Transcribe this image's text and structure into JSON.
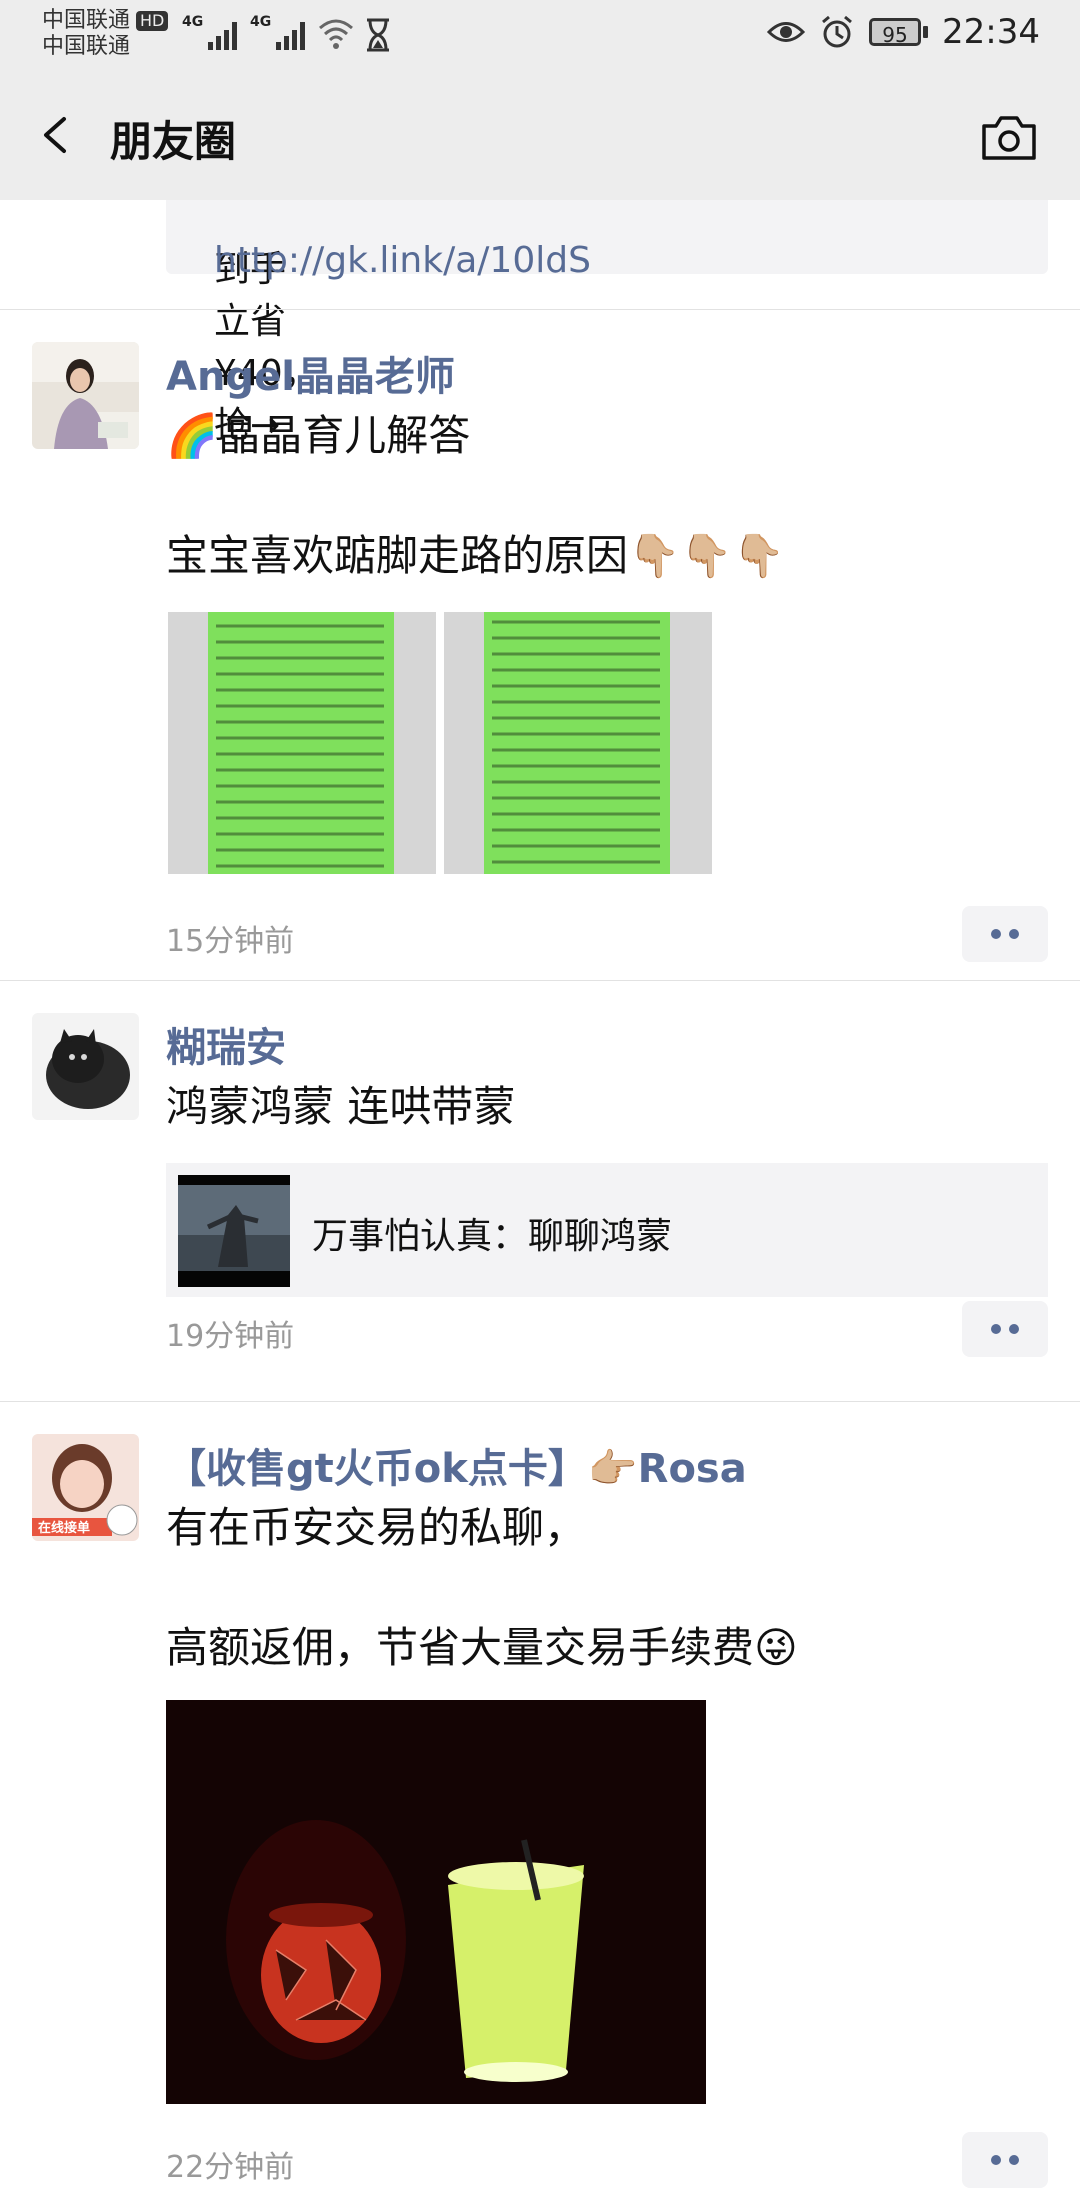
{
  "status_bar": {
    "carrier_1": "中国联通",
    "carrier_hd": "HD",
    "carrier_2": "中国联通",
    "net_1": "4G",
    "net_2": "4G",
    "battery": "95",
    "time": "22:34"
  },
  "nav": {
    "title": "朋友圈"
  },
  "top_snippet": {
    "text": "到手立省 ¥40，抢→",
    "link": "http://gk.link/a/10ldS"
  },
  "posts": [
    {
      "username": "Angel晶晶老师",
      "line_1": "🌈晶晶育儿解答",
      "line_2": "宝宝喜欢踮脚走路的原因👇🏼👇🏼👇🏼",
      "time": "15分钟前"
    },
    {
      "username": "糊瑞安",
      "line_1": "鸿蒙鸿蒙 连哄带蒙",
      "link_title": "万事怕认真：聊聊鸿蒙",
      "time": "19分钟前"
    },
    {
      "username": "【收售gt火币ok点卡】👉🏼Rosa",
      "line_1": "有在币安交易的私聊，",
      "line_2": "高额返佣，节省大量交易手续费😜",
      "avatar_badge": "在线接单",
      "time": "22分钟前"
    }
  ],
  "colors": {
    "link": "#576b95",
    "bar_bg": "#ededed",
    "card_bg": "#f3f3f5",
    "time_text": "#999999"
  }
}
